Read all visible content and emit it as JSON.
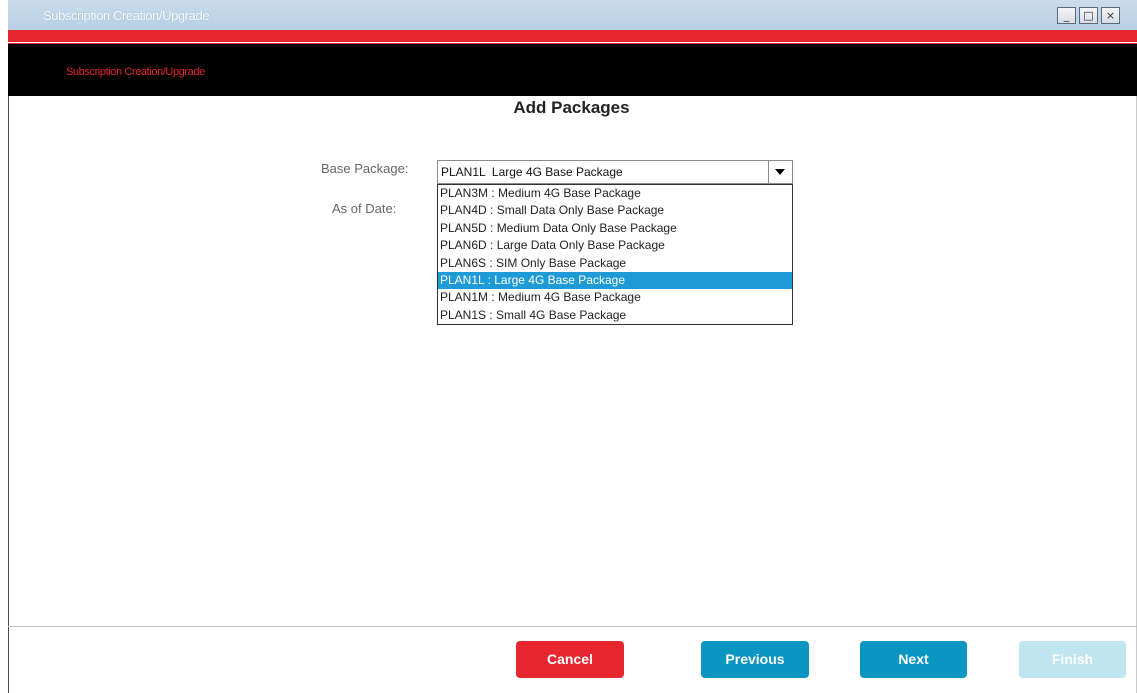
{
  "window": {
    "title": "Subscription Creation/Upgrade",
    "buttons": [
      "_",
      "□",
      "×"
    ]
  },
  "header": {
    "subtitle": "Subscription Creation/Upgrade"
  },
  "main": {
    "heading": "Add Packages",
    "base_package_label": "Base Package:",
    "as_of_date_label": "As of Date:",
    "base_package_value": "PLAN1L  Large 4G Base Package",
    "options": [
      "PLAN3M : Medium 4G Base Package",
      "PLAN4D : Small Data Only Base Package",
      "PLAN5D : Medium Data Only Base Package",
      "PLAN6D : Large Data Only Base Package",
      "PLAN6S : SIM Only Base Package",
      "PLAN1L : Large 4G Base Package",
      "PLAN1M : Medium 4G Base Package",
      "PLAN1S : Small 4G Base Package"
    ],
    "selected_option": "PLAN1L : Large 4G Base Package"
  },
  "footer": {
    "cancel_label": "Cancel",
    "previous_label": "Previous",
    "next_label": "Next",
    "finish_label": "Finish"
  },
  "colors": {
    "accent_red": "#e3262d",
    "button_blue": "#0b95c1",
    "selection_blue": "#1e9ad6",
    "disabled_blue": "#bfe5f1"
  }
}
